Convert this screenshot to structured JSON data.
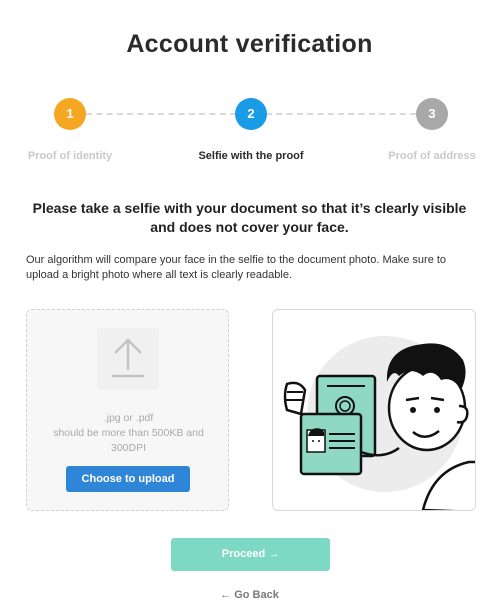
{
  "page": {
    "title": "Account verification"
  },
  "stepper": {
    "steps": [
      {
        "number": "1",
        "label": "Proof of identity",
        "state": "done",
        "color": "#f5a623"
      },
      {
        "number": "2",
        "label": "Selfie with the proof",
        "state": "active",
        "color": "#1a9be6"
      },
      {
        "number": "3",
        "label": "Proof of address",
        "state": "pending",
        "color": "#a8a8a8"
      }
    ]
  },
  "content": {
    "headline": "Please take a selfie with your document so that it’s clearly visible and does not cover your face.",
    "description": "Our algorithm will compare your face in the selfie to the document photo. Make sure to upload a bright photo where all text is clearly readable."
  },
  "upload": {
    "icon": "upload-arrow-icon",
    "hint_line1": ".jpg or .pdf",
    "hint_line2": "should be more than 500KB and 300DPI",
    "button_label": "Choose to upload",
    "button_color": "#2f86d6"
  },
  "illustration": {
    "icon": "selfie-with-document-illustration"
  },
  "actions": {
    "proceed_label": "Proceed →",
    "proceed_color": "#7dd9c3",
    "back_label": "← Go Back"
  }
}
